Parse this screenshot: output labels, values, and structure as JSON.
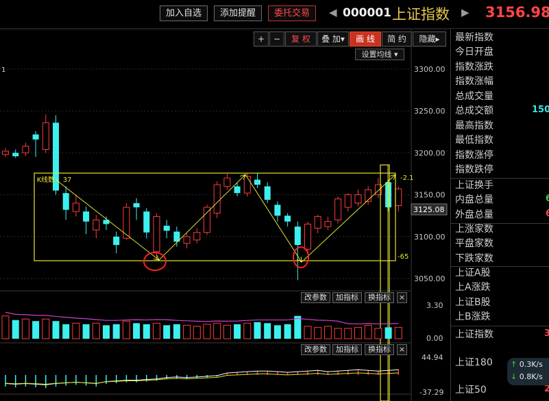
{
  "topbar": {
    "add_watch": "加入自选",
    "add_alert": "添加提醒",
    "trade": "委托交易",
    "prev_arrow": "◀",
    "next_arrow": "▶",
    "stock_code": "000001",
    "stock_name": "上证指数",
    "price": "3156.98"
  },
  "toolbar": {
    "plus": "+",
    "minus": "−",
    "adjust": "复 权",
    "overlay": "叠 加▾",
    "draw": "画 线",
    "simple": "简 约",
    "hide": "隐藏▸",
    "ma_setting": "设置均线 ▾"
  },
  "main_pane": {
    "corner_label": "1",
    "y_ticks": [
      "3300.00",
      "3250.00",
      "3200.00",
      "3150.00",
      "3100.00",
      "3050.00"
    ],
    "current_price_tag": "3125.08",
    "kline_count_label": "K线数: 37",
    "right_mark_upper": "-2.1",
    "right_mark_lower": "-65"
  },
  "volume_pane": {
    "params_btn": "改参数",
    "add_indicator_btn": "加指标",
    "switch_indicator_btn": "换指标",
    "close_btn": "×",
    "y_ticks": [
      "3.30",
      "0.00"
    ]
  },
  "macd_pane": {
    "params_btn": "改参数",
    "add_indicator_btn": "加指标",
    "switch_indicator_btn": "换指标",
    "close_btn": "×",
    "y_ticks": [
      "44.94",
      "-37.29"
    ]
  },
  "right_panel": {
    "group1": [
      "最新指数",
      "今日开盘",
      "指数涨跌",
      "指数涨幅",
      "总成交量",
      "总成交额",
      "最高指数",
      "最低指数",
      "指数涨停",
      "指数跌停"
    ],
    "turnover_value": "150",
    "group2": [
      "上证换手",
      "内盘总量",
      "外盘总量"
    ],
    "inner_value": "6",
    "outer_value": "6",
    "group3": [
      "上涨家数",
      "平盘家数",
      "下跌家数"
    ],
    "group4": [
      "上证A股",
      "上A涨跌",
      "上证B股",
      "上B涨跌"
    ],
    "index_list": [
      "上证指数",
      "上证180",
      "上证50"
    ],
    "index_value_1": "3",
    "index_value_3": "2",
    "speed_up": "0.3K/s",
    "speed_down": "0.8K/s"
  },
  "colors": {
    "up": "#ff3c3c",
    "down": "#3cf0f0",
    "annotation_box": "#e6e632",
    "circle": "#ff2020",
    "ma_line": "#ffffff",
    "volume_ma": "#d040d0"
  },
  "chart_data": {
    "type": "candlestick",
    "ylim": [
      3040,
      3310
    ],
    "y_ticks": [
      3300,
      3250,
      3200,
      3150,
      3100,
      3050
    ],
    "candles": [
      {
        "o": 3198,
        "c": 3202,
        "h": 3206,
        "l": 3195
      },
      {
        "o": 3200,
        "c": 3196,
        "h": 3204,
        "l": 3194
      },
      {
        "o": 3200,
        "c": 3208,
        "h": 3212,
        "l": 3196
      },
      {
        "o": 3222,
        "c": 3216,
        "h": 3226,
        "l": 3195
      },
      {
        "o": 3204,
        "c": 3236,
        "h": 3246,
        "l": 3200
      },
      {
        "o": 3236,
        "c": 3155,
        "h": 3245,
        "l": 3150
      },
      {
        "o": 3152,
        "c": 3132,
        "h": 3160,
        "l": 3120
      },
      {
        "o": 3130,
        "c": 3140,
        "h": 3150,
        "l": 3124
      },
      {
        "o": 3130,
        "c": 3118,
        "h": 3136,
        "l": 3103
      },
      {
        "o": 3108,
        "c": 3120,
        "h": 3126,
        "l": 3098
      },
      {
        "o": 3120,
        "c": 3115,
        "h": 3124,
        "l": 3108
      },
      {
        "o": 3100,
        "c": 3090,
        "h": 3106,
        "l": 3080
      },
      {
        "o": 3098,
        "c": 3135,
        "h": 3140,
        "l": 3096
      },
      {
        "o": 3140,
        "c": 3135,
        "h": 3146,
        "l": 3120
      },
      {
        "o": 3130,
        "c": 3105,
        "h": 3134,
        "l": 3098
      },
      {
        "o": 3082,
        "c": 3124,
        "h": 3128,
        "l": 3072
      },
      {
        "o": 3113,
        "c": 3107,
        "h": 3120,
        "l": 3098
      },
      {
        "o": 3106,
        "c": 3094,
        "h": 3112,
        "l": 3088
      },
      {
        "o": 3092,
        "c": 3100,
        "h": 3104,
        "l": 3086
      },
      {
        "o": 3096,
        "c": 3105,
        "h": 3110,
        "l": 3092
      },
      {
        "o": 3105,
        "c": 3135,
        "h": 3138,
        "l": 3102
      },
      {
        "o": 3128,
        "c": 3162,
        "h": 3166,
        "l": 3122
      },
      {
        "o": 3160,
        "c": 3170,
        "h": 3175,
        "l": 3156
      },
      {
        "o": 3160,
        "c": 3152,
        "h": 3164,
        "l": 3148
      },
      {
        "o": 3152,
        "c": 3172,
        "h": 3176,
        "l": 3148
      },
      {
        "o": 3168,
        "c": 3162,
        "h": 3176,
        "l": 3158
      },
      {
        "o": 3160,
        "c": 3144,
        "h": 3165,
        "l": 3140
      },
      {
        "o": 3138,
        "c": 3125,
        "h": 3142,
        "l": 3118
      },
      {
        "o": 3125,
        "c": 3118,
        "h": 3128,
        "l": 3112
      },
      {
        "o": 3112,
        "c": 3090,
        "h": 3118,
        "l": 3048
      },
      {
        "o": 3085,
        "c": 3115,
        "h": 3118,
        "l": 3080
      },
      {
        "o": 3110,
        "c": 3124,
        "h": 3126,
        "l": 3104
      },
      {
        "o": 3112,
        "c": 3118,
        "h": 3124,
        "l": 3108
      },
      {
        "o": 3120,
        "c": 3145,
        "h": 3148,
        "l": 3116
      },
      {
        "o": 3135,
        "c": 3150,
        "h": 3152,
        "l": 3130
      },
      {
        "o": 3140,
        "c": 3150,
        "h": 3156,
        "l": 3136
      },
      {
        "o": 3142,
        "c": 3156,
        "h": 3160,
        "l": 3138
      },
      {
        "o": 3150,
        "c": 3162,
        "h": 3170,
        "l": 3146
      },
      {
        "o": 3165,
        "c": 3135,
        "h": 3168,
        "l": 3130
      },
      {
        "o": 3137,
        "c": 3157,
        "h": 3160,
        "l": 3130
      }
    ],
    "volume": [
      2.2,
      1.8,
      1.9,
      1.7,
      1.9,
      1.7,
      1.4,
      1.5,
      1.4,
      1.5,
      1.3,
      1.4,
      1.7,
      1.5,
      1.4,
      1.5,
      1.3,
      1.4,
      1.3,
      1.2,
      1.4,
      1.5,
      1.3,
      1.4,
      1.5,
      1.6,
      1.5,
      1.3,
      1.4,
      2.2,
      1.2,
      1.1,
      1.2,
      1.0,
      1.0,
      1.1,
      1.3,
      1.0,
      1.1,
      1.1
    ],
    "macd_hist": [
      -14,
      -15,
      -14,
      -15,
      -16,
      -14,
      -13,
      -12,
      -13,
      -14,
      -11,
      -10,
      -9,
      -9,
      -8,
      -7,
      -5,
      -4,
      -5,
      -4,
      -3,
      -2,
      2,
      3,
      4,
      5,
      5,
      4,
      3,
      4,
      5,
      6,
      4,
      5,
      6,
      7,
      6,
      5,
      6,
      7
    ]
  }
}
